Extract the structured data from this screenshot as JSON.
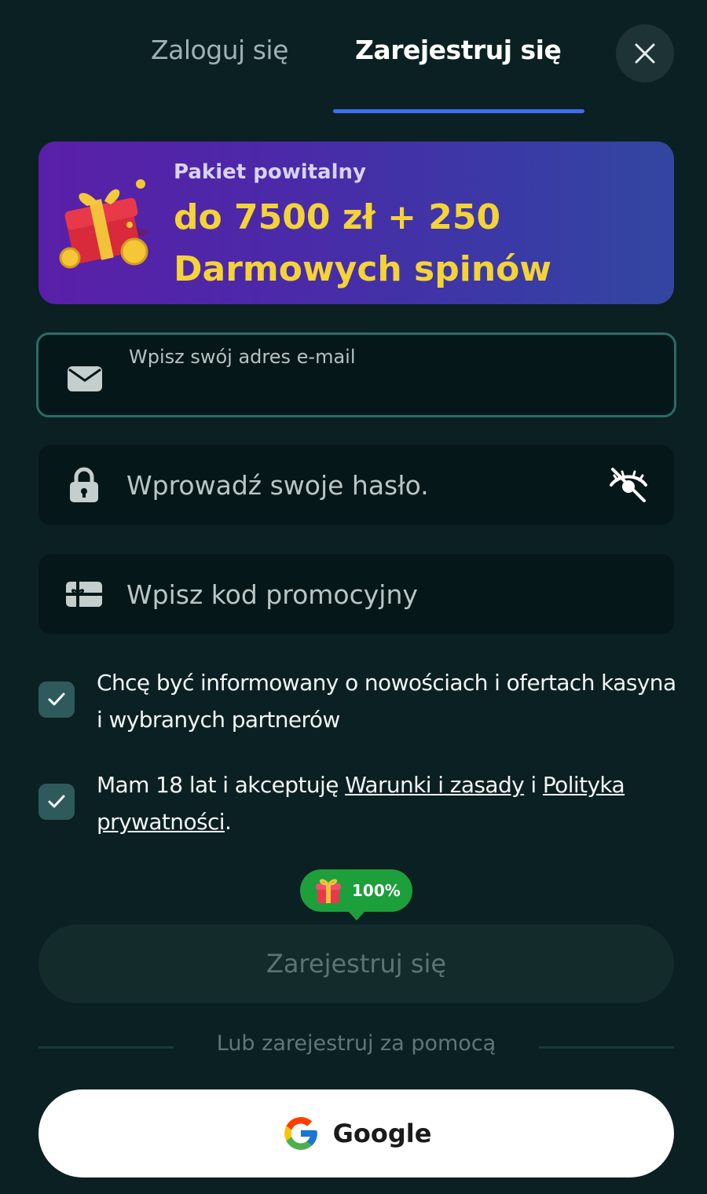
{
  "tabs": {
    "login_label": "Zaloguj się",
    "register_label": "Zarejestruj się",
    "active": "register"
  },
  "banner": {
    "kicker": "Pakiet powitalny",
    "title_line1": "do 7500 zł + 250",
    "title_line2": "Darmowych spinów",
    "icon": "gift-with-coins-icon"
  },
  "form": {
    "email": {
      "label": "Wpisz swój adres e-mail",
      "value": "",
      "icon": "envelope-icon"
    },
    "password": {
      "placeholder": "Wprowadź swoje hasło.",
      "value": "",
      "icon": "lock-icon",
      "toggle_icon": "eye-off-icon"
    },
    "promo": {
      "placeholder": "Wpisz kod promocyjny",
      "value": "",
      "icon": "gift-card-icon"
    }
  },
  "consents": {
    "newsletter": {
      "checked": true,
      "text": "Chcę być informowany o nowościach i ofertach kasyna i wybranych partnerów"
    },
    "terms": {
      "checked": true,
      "text_before": "Mam 18 lat i akceptuję ",
      "terms_link": "Warunki i zasady",
      "text_middle": " i ",
      "privacy_link": "Polityka prywatności",
      "text_after": "."
    }
  },
  "bonus_badge": {
    "value": "100%",
    "icon": "gift-icon"
  },
  "register_button": {
    "label": "Zarejestruj się",
    "enabled": false
  },
  "divider": {
    "text": "Lub zarejestruj za pomocą"
  },
  "social": {
    "google_label": "Google"
  },
  "colors": {
    "background": "#0b2022",
    "tab_underline": "#3b6ef0",
    "banner_accent": "#f4d336",
    "checkbox": "#2f5a5b",
    "bonus_badge": "#1d9f3c"
  }
}
